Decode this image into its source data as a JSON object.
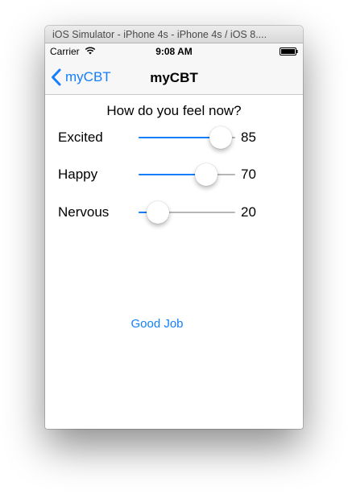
{
  "window": {
    "title": "iOS Simulator - iPhone 4s - iPhone 4s / iOS 8...."
  },
  "status_bar": {
    "carrier": "Carrier",
    "time": "9:08 AM"
  },
  "nav": {
    "back_label": "myCBT",
    "title": "myCBT"
  },
  "content": {
    "question": "How do you feel now?",
    "sliders": [
      {
        "label": "Excited",
        "value": 85,
        "value_text": "85",
        "min": 0,
        "max": 100
      },
      {
        "label": "Happy",
        "value": 70,
        "value_text": "70",
        "min": 0,
        "max": 100
      },
      {
        "label": "Nervous",
        "value": 20,
        "value_text": "20",
        "min": 0,
        "max": 100
      }
    ],
    "button_label": "Good Job"
  },
  "colors": {
    "accent": "#147efb",
    "track": "#b6b6b6"
  }
}
